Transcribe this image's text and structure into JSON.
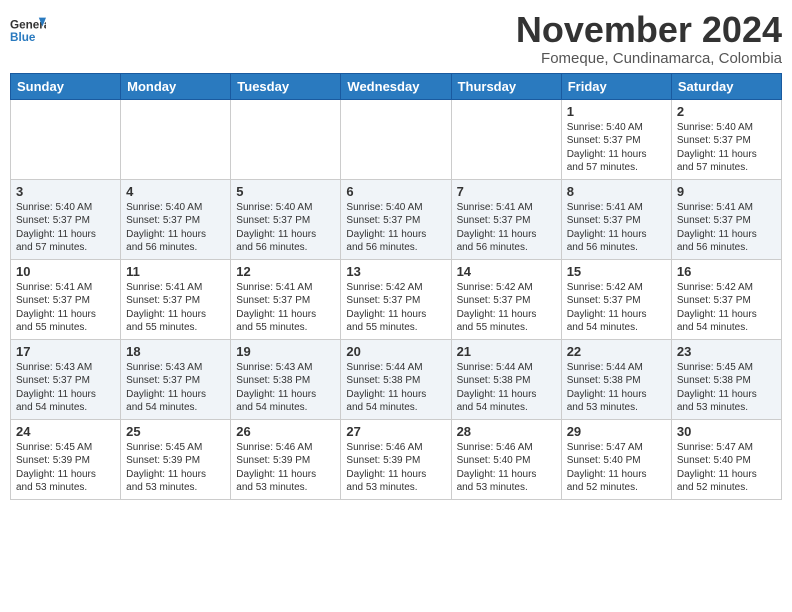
{
  "logo": {
    "general": "General",
    "blue": "Blue"
  },
  "header": {
    "month": "November 2024",
    "location": "Fomeque, Cundinamarca, Colombia"
  },
  "weekdays": [
    "Sunday",
    "Monday",
    "Tuesday",
    "Wednesday",
    "Thursday",
    "Friday",
    "Saturday"
  ],
  "weeks": [
    [
      {
        "day": "",
        "content": ""
      },
      {
        "day": "",
        "content": ""
      },
      {
        "day": "",
        "content": ""
      },
      {
        "day": "",
        "content": ""
      },
      {
        "day": "",
        "content": ""
      },
      {
        "day": "1",
        "content": "Sunrise: 5:40 AM\nSunset: 5:37 PM\nDaylight: 11 hours and 57 minutes."
      },
      {
        "day": "2",
        "content": "Sunrise: 5:40 AM\nSunset: 5:37 PM\nDaylight: 11 hours and 57 minutes."
      }
    ],
    [
      {
        "day": "3",
        "content": "Sunrise: 5:40 AM\nSunset: 5:37 PM\nDaylight: 11 hours and 57 minutes."
      },
      {
        "day": "4",
        "content": "Sunrise: 5:40 AM\nSunset: 5:37 PM\nDaylight: 11 hours and 56 minutes."
      },
      {
        "day": "5",
        "content": "Sunrise: 5:40 AM\nSunset: 5:37 PM\nDaylight: 11 hours and 56 minutes."
      },
      {
        "day": "6",
        "content": "Sunrise: 5:40 AM\nSunset: 5:37 PM\nDaylight: 11 hours and 56 minutes."
      },
      {
        "day": "7",
        "content": "Sunrise: 5:41 AM\nSunset: 5:37 PM\nDaylight: 11 hours and 56 minutes."
      },
      {
        "day": "8",
        "content": "Sunrise: 5:41 AM\nSunset: 5:37 PM\nDaylight: 11 hours and 56 minutes."
      },
      {
        "day": "9",
        "content": "Sunrise: 5:41 AM\nSunset: 5:37 PM\nDaylight: 11 hours and 56 minutes."
      }
    ],
    [
      {
        "day": "10",
        "content": "Sunrise: 5:41 AM\nSunset: 5:37 PM\nDaylight: 11 hours and 55 minutes."
      },
      {
        "day": "11",
        "content": "Sunrise: 5:41 AM\nSunset: 5:37 PM\nDaylight: 11 hours and 55 minutes."
      },
      {
        "day": "12",
        "content": "Sunrise: 5:41 AM\nSunset: 5:37 PM\nDaylight: 11 hours and 55 minutes."
      },
      {
        "day": "13",
        "content": "Sunrise: 5:42 AM\nSunset: 5:37 PM\nDaylight: 11 hours and 55 minutes."
      },
      {
        "day": "14",
        "content": "Sunrise: 5:42 AM\nSunset: 5:37 PM\nDaylight: 11 hours and 55 minutes."
      },
      {
        "day": "15",
        "content": "Sunrise: 5:42 AM\nSunset: 5:37 PM\nDaylight: 11 hours and 54 minutes."
      },
      {
        "day": "16",
        "content": "Sunrise: 5:42 AM\nSunset: 5:37 PM\nDaylight: 11 hours and 54 minutes."
      }
    ],
    [
      {
        "day": "17",
        "content": "Sunrise: 5:43 AM\nSunset: 5:37 PM\nDaylight: 11 hours and 54 minutes."
      },
      {
        "day": "18",
        "content": "Sunrise: 5:43 AM\nSunset: 5:37 PM\nDaylight: 11 hours and 54 minutes."
      },
      {
        "day": "19",
        "content": "Sunrise: 5:43 AM\nSunset: 5:38 PM\nDaylight: 11 hours and 54 minutes."
      },
      {
        "day": "20",
        "content": "Sunrise: 5:44 AM\nSunset: 5:38 PM\nDaylight: 11 hours and 54 minutes."
      },
      {
        "day": "21",
        "content": "Sunrise: 5:44 AM\nSunset: 5:38 PM\nDaylight: 11 hours and 54 minutes."
      },
      {
        "day": "22",
        "content": "Sunrise: 5:44 AM\nSunset: 5:38 PM\nDaylight: 11 hours and 53 minutes."
      },
      {
        "day": "23",
        "content": "Sunrise: 5:45 AM\nSunset: 5:38 PM\nDaylight: 11 hours and 53 minutes."
      }
    ],
    [
      {
        "day": "24",
        "content": "Sunrise: 5:45 AM\nSunset: 5:39 PM\nDaylight: 11 hours and 53 minutes."
      },
      {
        "day": "25",
        "content": "Sunrise: 5:45 AM\nSunset: 5:39 PM\nDaylight: 11 hours and 53 minutes."
      },
      {
        "day": "26",
        "content": "Sunrise: 5:46 AM\nSunset: 5:39 PM\nDaylight: 11 hours and 53 minutes."
      },
      {
        "day": "27",
        "content": "Sunrise: 5:46 AM\nSunset: 5:39 PM\nDaylight: 11 hours and 53 minutes."
      },
      {
        "day": "28",
        "content": "Sunrise: 5:46 AM\nSunset: 5:40 PM\nDaylight: 11 hours and 53 minutes."
      },
      {
        "day": "29",
        "content": "Sunrise: 5:47 AM\nSunset: 5:40 PM\nDaylight: 11 hours and 52 minutes."
      },
      {
        "day": "30",
        "content": "Sunrise: 5:47 AM\nSunset: 5:40 PM\nDaylight: 11 hours and 52 minutes."
      }
    ]
  ]
}
